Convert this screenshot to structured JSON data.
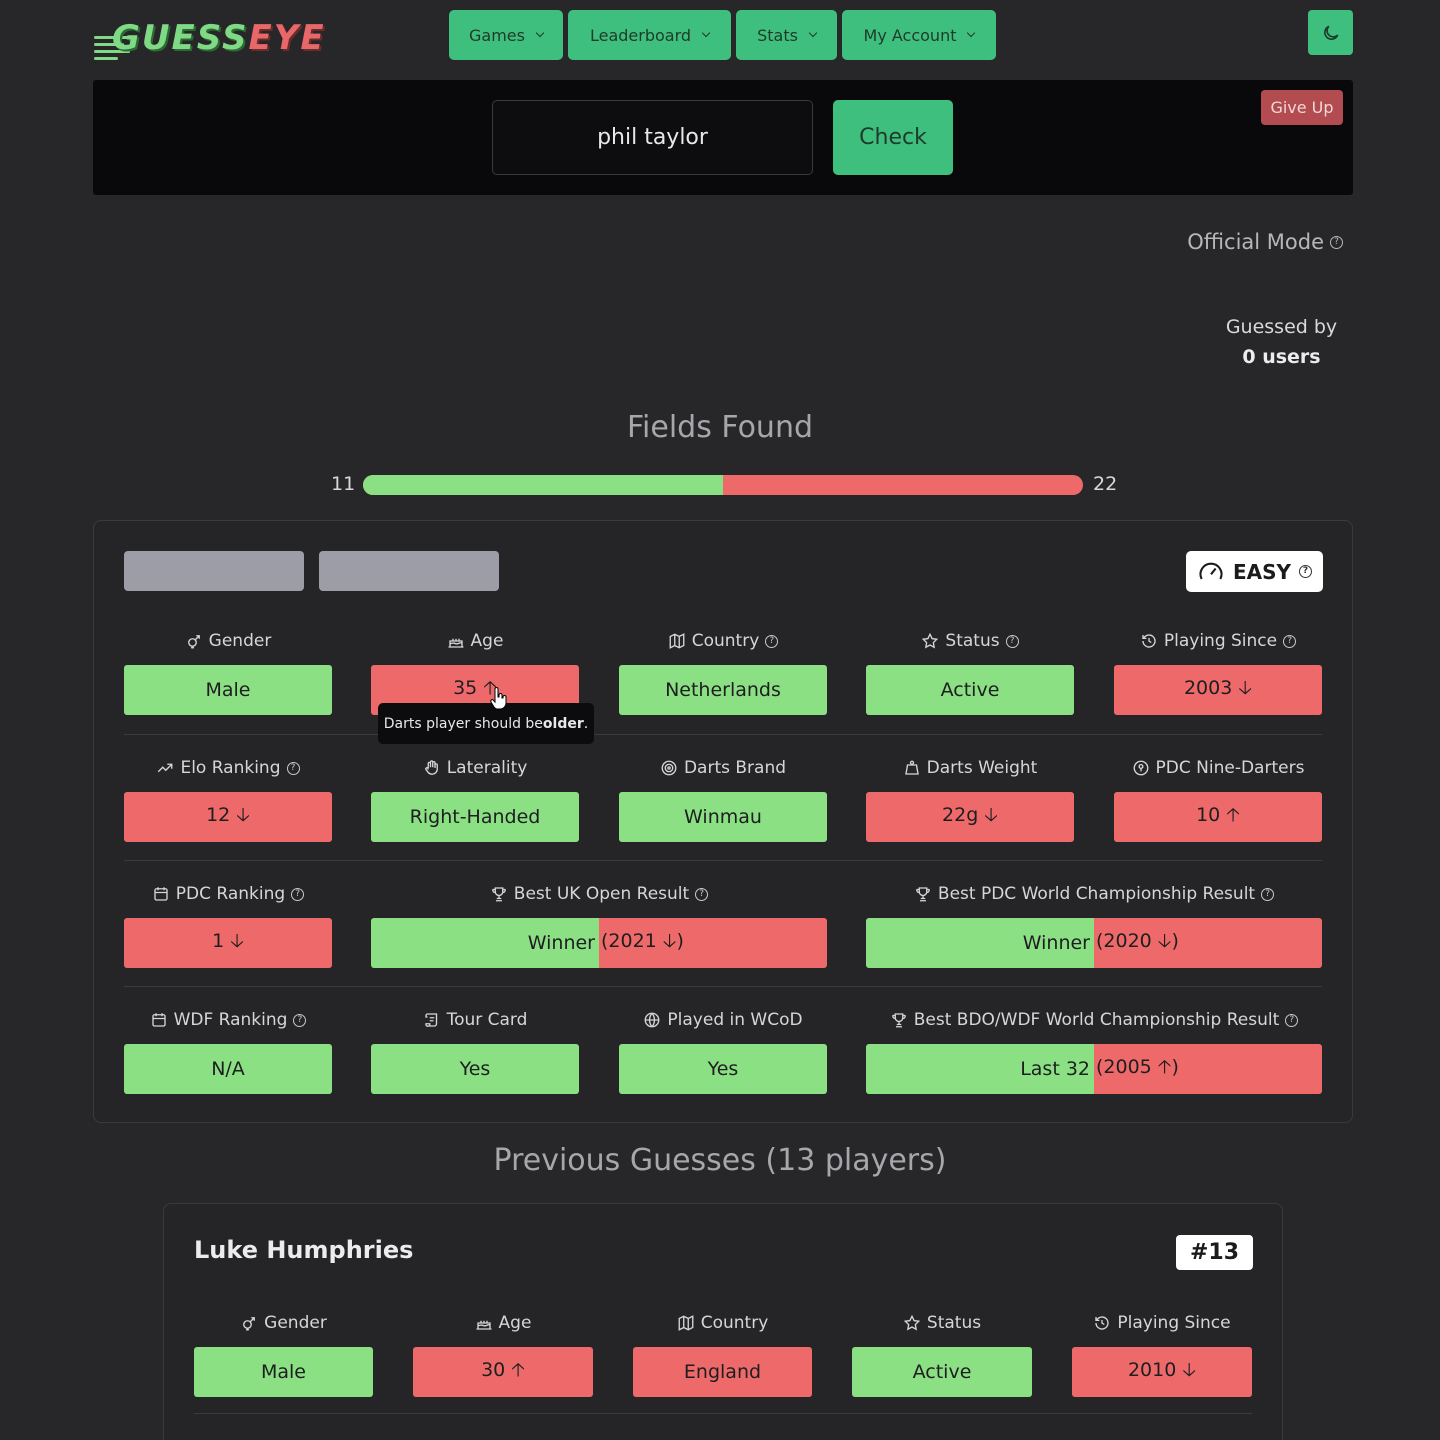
{
  "brand": {
    "logo_main": "GUESS",
    "logo_accent": "EYE"
  },
  "nav": {
    "games": "Games",
    "leaderboard": "Leaderboard",
    "stats": "Stats",
    "account": "My Account"
  },
  "search": {
    "value": "phil taylor",
    "check_label": "Check",
    "giveup_label": "Give Up"
  },
  "mode": {
    "label": "Official Mode"
  },
  "guessed_by": {
    "line1": "Guessed by",
    "line2": "0 users"
  },
  "fields_found": {
    "title": "Fields Found",
    "found": "11",
    "total": "22",
    "fraction": 0.5
  },
  "difficulty": "EASY",
  "tooltip": {
    "prefix": "Darts player should be ",
    "emph": "older",
    "suffix": "."
  },
  "fields": {
    "gender": {
      "label": "Gender",
      "value": "Male"
    },
    "age": {
      "label": "Age",
      "value": "35 🡡"
    },
    "country": {
      "label": "Country",
      "value": "Netherlands"
    },
    "status": {
      "label": "Status",
      "value": "Active"
    },
    "playing_since": {
      "label": "Playing Since",
      "value": "2003 🡣"
    },
    "elo": {
      "label": "Elo Ranking",
      "value": "12 🡣"
    },
    "laterality": {
      "label": "Laterality",
      "value": "Right-Handed"
    },
    "brand": {
      "label": "Darts Brand",
      "value": "Winmau"
    },
    "weight": {
      "label": "Darts Weight",
      "value": "22g 🡣"
    },
    "nine_darters": {
      "label": "PDC Nine-Darters",
      "value": "10 🡡"
    },
    "pdc_ranking": {
      "label": "PDC Ranking",
      "value": "1 🡣"
    },
    "uk_open": {
      "label": "Best UK Open Result",
      "value": "Winner",
      "extra": "(2021 🡣)"
    },
    "pdc_wc": {
      "label": "Best PDC World Championship Result",
      "value": "Winner",
      "extra": "(2020 🡣)"
    },
    "wdf_ranking": {
      "label": "WDF Ranking",
      "value": "N/A"
    },
    "tour_card": {
      "label": "Tour Card",
      "value": "Yes"
    },
    "wcod": {
      "label": "Played in WCoD",
      "value": "Yes"
    },
    "bdo_wc": {
      "label": "Best BDO/WDF World Championship Result",
      "value": "Last 32",
      "extra": "(2005 🡡)"
    }
  },
  "previous": {
    "title": "Previous Guesses (13 players)",
    "first": {
      "name": "Luke Humphries",
      "badge": "#13",
      "gender": {
        "label": "Gender",
        "value": "Male"
      },
      "age": {
        "label": "Age",
        "value": "30 🡡"
      },
      "country": {
        "label": "Country",
        "value": "England"
      },
      "status": {
        "label": "Status",
        "value": "Active"
      },
      "playing_since": {
        "label": "Playing Since",
        "value": "2010 🡣"
      }
    }
  },
  "colors": {
    "accent": "#3fbf7d",
    "correct": "#8be084",
    "wrong": "#ee6a6a",
    "give_up": "#b34c50"
  }
}
